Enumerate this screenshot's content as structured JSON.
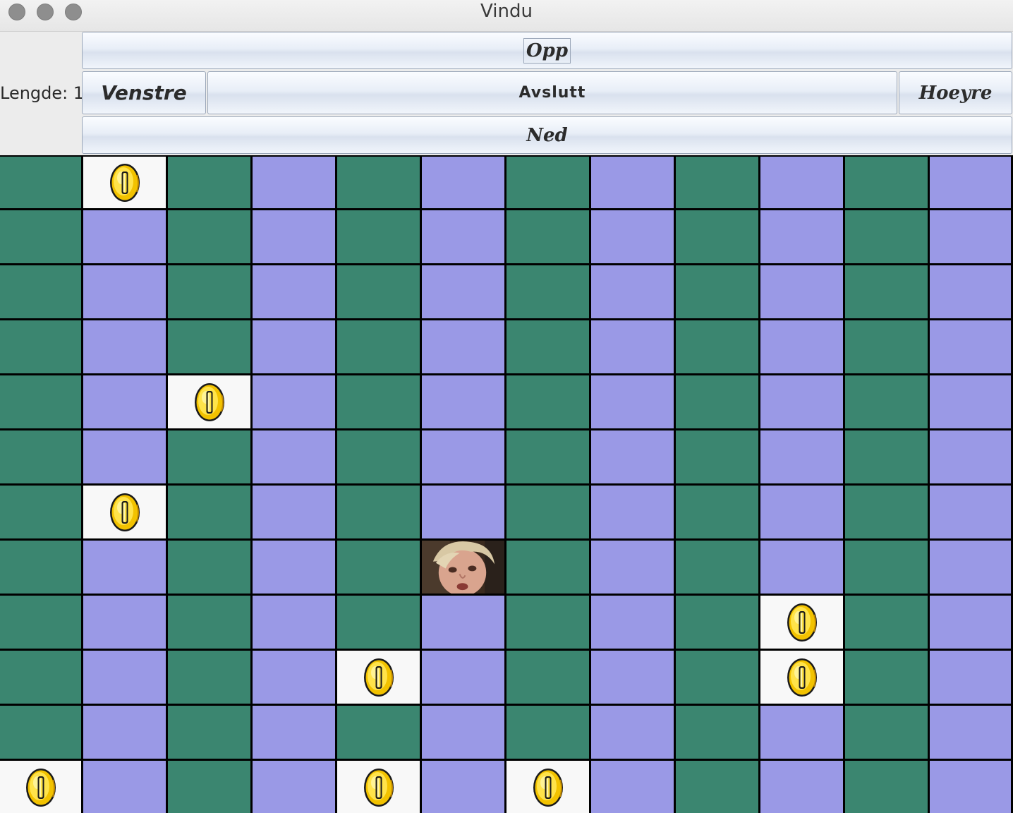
{
  "window": {
    "title": "Vindu"
  },
  "controls": {
    "score_text": "Lengde: 1",
    "up_label": "Opp",
    "left_label": "Venstre",
    "quit_label": "Avslutt",
    "right_label": "Hoeyre",
    "down_label": "Ned"
  },
  "board": {
    "cols": 12,
    "rows": 12,
    "colors": {
      "green": "#3b8670",
      "purple": "#9a99e6",
      "coin_cell": "#f8f8f8",
      "grid": "#000000"
    },
    "coins": [
      [
        0,
        1
      ],
      [
        4,
        2
      ],
      [
        6,
        1
      ],
      [
        8,
        9
      ],
      [
        9,
        4
      ],
      [
        9,
        9
      ],
      [
        11,
        0
      ],
      [
        11,
        4
      ],
      [
        11,
        6
      ]
    ],
    "player": [
      7,
      5
    ],
    "icons": {
      "coin": "gold-coin-icon",
      "player": "player-face-icon"
    }
  }
}
